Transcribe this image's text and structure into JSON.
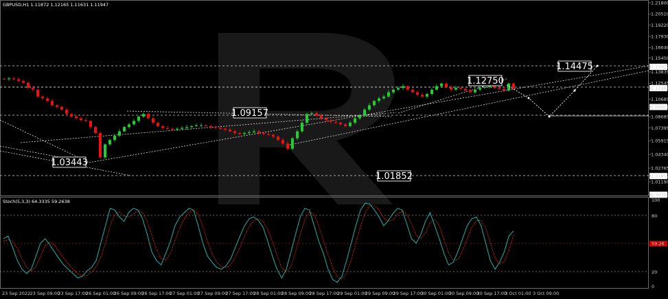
{
  "header": {
    "main": "GBPUSD,H1  1.11872 1.12165 1.11631 1.11947",
    "osc": "Stoch(5,3,3) 64.3335 59.2638"
  },
  "chart_data": {
    "type": "candlestick",
    "symbol": "GBPUSD",
    "timeframe": "H1",
    "ylim": [
      0.997,
      1.218
    ],
    "y_ticks": [
      "1.21800",
      "1.20510",
      "1.19220",
      "1.17930",
      "1.16640",
      "1.15450",
      "1.14427",
      "1.13835",
      "1.12545",
      "1.11968",
      "1.10685",
      "1.09801",
      "1.08685",
      "1.07395",
      "1.05915",
      "1.04340",
      "1.02765",
      "1.01852",
      "1.01190",
      "0.99702"
    ],
    "highlight_ticks": [
      "1.14427",
      "1.11968",
      "1.09801",
      "1.01852",
      "0.99702"
    ],
    "x_labels": [
      "23 Sep 2022",
      "23 Sep 09:00",
      "23 Sep 17:00",
      "26 Sep 01:00",
      "26 Sep 09:00",
      "26 Sep 17:00",
      "27 Sep 01:00",
      "27 Sep 09:00",
      "27 Sep 17:00",
      "28 Sep 01:00",
      "28 Sep 09:00",
      "28 Sep 17:00",
      "29 Sep 01:00",
      "29 Sep 09:00",
      "29 Sep 17:00",
      "30 Sep 01:00",
      "30 Sep 09:00",
      "30 Sep 17:00",
      "3 Oct 01:00",
      "3 Oct 09:00"
    ],
    "closes": [
      1.13,
      1.131,
      1.13,
      1.128,
      1.126,
      1.12,
      1.118,
      1.11,
      1.108,
      1.105,
      1.1,
      1.098,
      1.095,
      1.09,
      1.087,
      1.085,
      1.083,
      1.082,
      1.075,
      1.068,
      1.04,
      1.055,
      1.06,
      1.065,
      1.07,
      1.075,
      1.078,
      1.082,
      1.087,
      1.09,
      1.085,
      1.08,
      1.076,
      1.074,
      1.073,
      1.072,
      1.073,
      1.074,
      1.075,
      1.076,
      1.077,
      1.077,
      1.076,
      1.075,
      1.074,
      1.073,
      1.072,
      1.07,
      1.068,
      1.067,
      1.068,
      1.069,
      1.07,
      1.068,
      1.067,
      1.066,
      1.064,
      1.06,
      1.056,
      1.05,
      1.062,
      1.07,
      1.08,
      1.09,
      1.091,
      1.088,
      1.085,
      1.083,
      1.081,
      1.08,
      1.078,
      1.076,
      1.08,
      1.085,
      1.088,
      1.095,
      1.1,
      1.105,
      1.108,
      1.11,
      1.115,
      1.118,
      1.12,
      1.122,
      1.118,
      1.115,
      1.112,
      1.11,
      1.113,
      1.118,
      1.122,
      1.125,
      1.121,
      1.118,
      1.12,
      1.119,
      1.117,
      1.115,
      1.118,
      1.12,
      1.121,
      1.122,
      1.12,
      1.119,
      1.117,
      1.125,
      1.1195
    ],
    "stoch_main": [
      55,
      58,
      45,
      30,
      20,
      15,
      20,
      35,
      50,
      55,
      48,
      40,
      32,
      25,
      20,
      15,
      10,
      12,
      18,
      22,
      30,
      50,
      70,
      90,
      88,
      80,
      75,
      85,
      90,
      88,
      78,
      60,
      40,
      30,
      25,
      38,
      52,
      70,
      80,
      85,
      90,
      88,
      70,
      50,
      35,
      28,
      22,
      20,
      24,
      32,
      45,
      58,
      70,
      78,
      80,
      76,
      68,
      52,
      35,
      20,
      10,
      20,
      40,
      60,
      80,
      90,
      88,
      70,
      52,
      38,
      20,
      8,
      5,
      12,
      30,
      50,
      70,
      88,
      96,
      95,
      88,
      80,
      70,
      76,
      84,
      90,
      88,
      72,
      55,
      50,
      60,
      75,
      85,
      70,
      55,
      38,
      25,
      28,
      40,
      55,
      70,
      78,
      80,
      70,
      50,
      30,
      20,
      28,
      40,
      58,
      64
    ],
    "stoch_signal": [
      52,
      54,
      52,
      44,
      32,
      22,
      18,
      23,
      35,
      47,
      51,
      48,
      40,
      33,
      26,
      20,
      15,
      12,
      13,
      17,
      23,
      34,
      50,
      70,
      83,
      86,
      81,
      80,
      83,
      88,
      85,
      75,
      59,
      43,
      32,
      31,
      38,
      53,
      67,
      78,
      85,
      88,
      83,
      69,
      52,
      38,
      28,
      23,
      22,
      25,
      34,
      45,
      58,
      69,
      76,
      78,
      75,
      65,
      52,
      36,
      22,
      17,
      23,
      40,
      60,
      77,
      86,
      83,
      70,
      53,
      37,
      22,
      11,
      9,
      16,
      31,
      50,
      69,
      85,
      93,
      93,
      88,
      79,
      75,
      77,
      83,
      87,
      83,
      72,
      59,
      55,
      62,
      73,
      77,
      70,
      54,
      39,
      30,
      31,
      41,
      55,
      68,
      76,
      76,
      67,
      50,
      33,
      26,
      29,
      42,
      59
    ],
    "stoch_levels": [
      20,
      50,
      80
    ],
    "annotations": [
      {
        "label": "1.14475",
        "type": "target"
      },
      {
        "label": "1.12750",
        "type": "target"
      },
      {
        "label": "1.09157",
        "type": "target"
      },
      {
        "label": "1.03443",
        "type": "target"
      },
      {
        "label": "1.01852",
        "type": "target"
      }
    ]
  },
  "colors": {
    "bg": "#000000",
    "bull": "#22cc33",
    "bear": "#ee1111",
    "stoch_main": "#20b2aa",
    "stoch_signal": "#dd2222",
    "axis": "#9a9a9a",
    "highlight_label_bg": "#ffffff",
    "highlight_label_fg": "#000000",
    "stoch_current_label_bg": "#cc0000"
  }
}
